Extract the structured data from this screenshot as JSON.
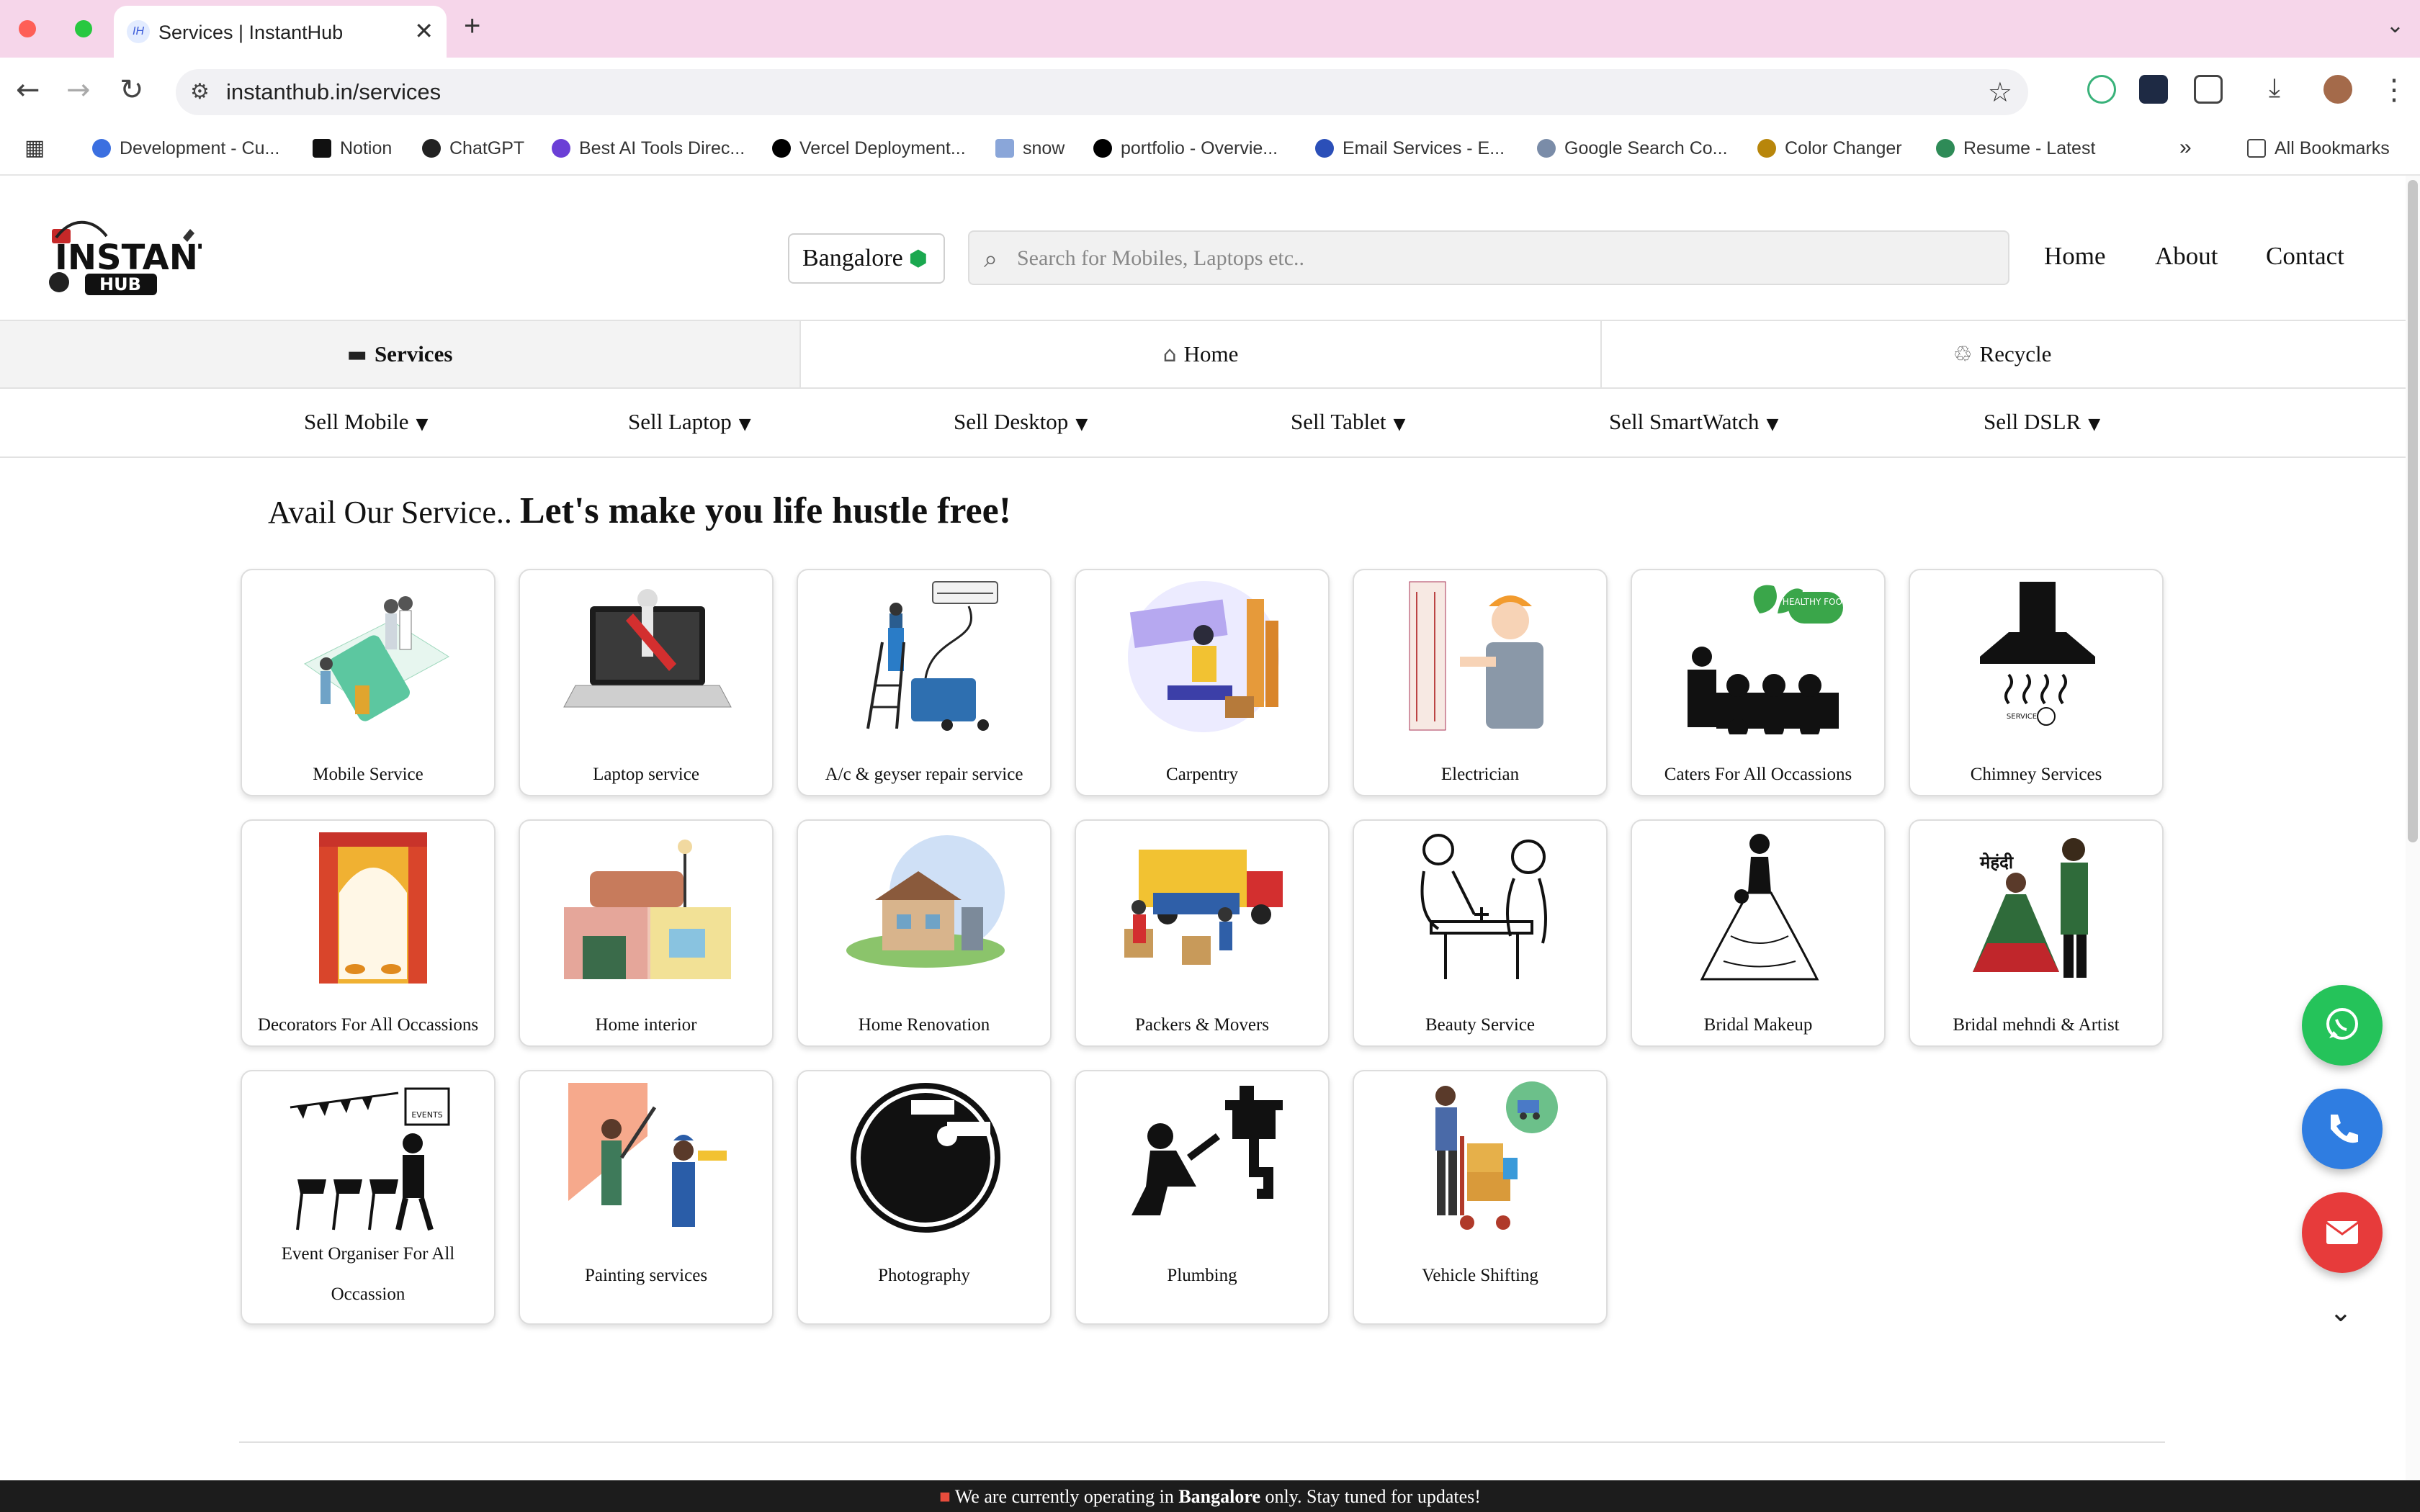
{
  "browser": {
    "tab_title": "Services | InstantHub",
    "tab_favicon": "IH",
    "url": "instanthub.in/services",
    "bookmarks": [
      {
        "label": "Development - Cu...",
        "color": "#3b6fe0"
      },
      {
        "label": "Notion",
        "color": "#111111"
      },
      {
        "label": "ChatGPT",
        "color": "#222222"
      },
      {
        "label": "Best AI Tools Direc...",
        "color": "#6b3fd6"
      },
      {
        "label": "Vercel Deployment...",
        "color": "#000000"
      },
      {
        "label": "snow",
        "color": "#8aa6d9"
      },
      {
        "label": "portfolio - Overvie...",
        "color": "#000000"
      },
      {
        "label": "Email Services - E...",
        "color": "#2b4fb8"
      },
      {
        "label": "Google Search Co...",
        "color": "#7a8ca8"
      },
      {
        "label": "Color Changer",
        "color": "#b8860b"
      },
      {
        "label": "Resume - Latest",
        "color": "#2e8b57"
      }
    ],
    "all_bookmarks": "All Bookmarks"
  },
  "header": {
    "logo_text": "INSTANT HUB",
    "city": "Bangalore",
    "search_placeholder": "Search for Mobiles, Laptops etc..",
    "nav": [
      "Home",
      "About",
      "Contact"
    ]
  },
  "categories": [
    {
      "label": "Services",
      "icon": "toolbox-icon",
      "active": true
    },
    {
      "label": "Home",
      "icon": "home-icon",
      "active": false
    },
    {
      "label": "Recycle",
      "icon": "recycle-icon",
      "active": false
    }
  ],
  "sell_menu": [
    "Sell Mobile",
    "Sell Laptop",
    "Sell Desktop",
    "Sell Tablet",
    "Sell SmartWatch",
    "Sell DSLR"
  ],
  "main": {
    "heading_prefix": "Avail Our Service..",
    "heading_bold": "Let's make you life hustle free!"
  },
  "services": [
    "Mobile Service",
    "Laptop service",
    "A/c & geyser repair service",
    "Carpentry",
    "Electrician",
    "Caters For All Occassions",
    "Chimney Services",
    "Decorators For All Occassions",
    "Home interior",
    "Home Renovation",
    "Packers & Movers",
    "Beauty Service",
    "Bridal Makeup",
    "Bridal mehndi & Artist",
    "Event Organiser For All Occassion",
    "Painting services",
    "Photography",
    "Plumbing",
    "Vehicle Shifting"
  ],
  "image_text": {
    "healthy_food": "HEALTHY FOOD",
    "service": "SERVICE",
    "events": "EVENTS",
    "mehndi": "मेहंदी"
  },
  "footer_banner": {
    "prefix": "We are currently operating in",
    "city": "Bangalore",
    "suffix": "only. Stay tuned for updates!"
  },
  "colors": {
    "whatsapp": "#25c35a",
    "call": "#2f7de1",
    "email": "#e73b3b",
    "tabbar": "#f6d6ea"
  }
}
